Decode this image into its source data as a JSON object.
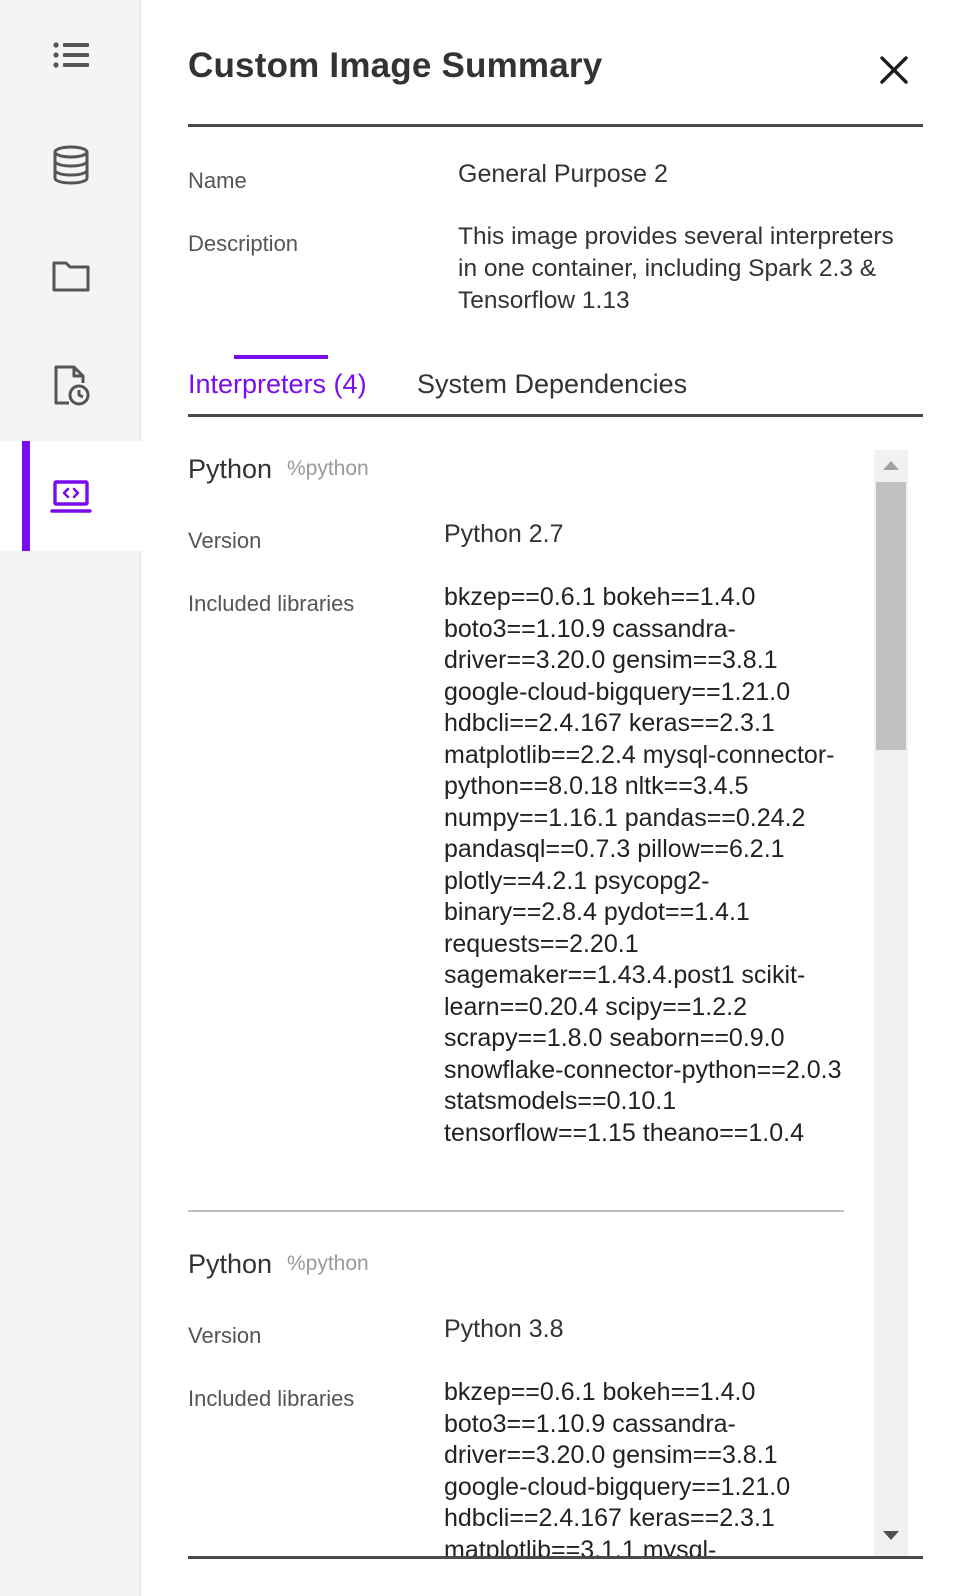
{
  "colors": {
    "accent": "#7a0cf0",
    "rail_bg": "#f4f4f6"
  },
  "rail": {
    "items": [
      {
        "icon": "list-icon"
      },
      {
        "icon": "database-icon"
      },
      {
        "icon": "folder-icon"
      },
      {
        "icon": "file-history-icon"
      },
      {
        "icon": "code-laptop-icon",
        "active": true
      }
    ]
  },
  "panel": {
    "title": "Custom Image Summary",
    "name_label": "Name",
    "name_value": "General Purpose 2",
    "description_label": "Description",
    "description_value": "This image provides several interpreters in one container, including Spark 2.3 & Tensorflow 1.13"
  },
  "tabs": {
    "interpreters": "Interpreters (4)",
    "system_dependencies": "System Dependencies"
  },
  "interpreters": [
    {
      "name": "Python",
      "tag": "%python",
      "version_label": "Version",
      "version": "Python 2.7",
      "libraries_label": "Included libraries",
      "libraries": "bkzep==0.6.1 bokeh==1.4.0 boto3==1.10.9 cassandra-driver==3.20.0 gensim==3.8.1 google-cloud-bigquery==1.21.0 hdbcli==2.4.167 keras==2.3.1 matplotlib==2.2.4 mysql-connector-python==8.0.18 nltk==3.4.5 numpy==1.16.1 pandas==0.24.2 pandasql==0.7.3 pillow==6.2.1 plotly==4.2.1 psycopg2-binary==2.8.4 pydot==1.4.1 requests==2.20.1 sagemaker==1.43.4.post1 scikit-learn==0.20.4 scipy==1.2.2 scrapy==1.8.0 seaborn==0.9.0 snowflake-connector-python==2.0.3 statsmodels==0.10.1 tensorflow==1.15 theano==1.0.4"
    },
    {
      "name": "Python",
      "tag": "%python",
      "version_label": "Version",
      "version": "Python 3.8",
      "libraries_label": "Included libraries",
      "libraries": "bkzep==0.6.1 bokeh==1.4.0 boto3==1.10.9 cassandra-driver==3.20.0 gensim==3.8.1 google-cloud-bigquery==1.21.0 hdbcli==2.4.167 keras==2.3.1 matplotlib==3.1.1 mysql-"
    }
  ]
}
